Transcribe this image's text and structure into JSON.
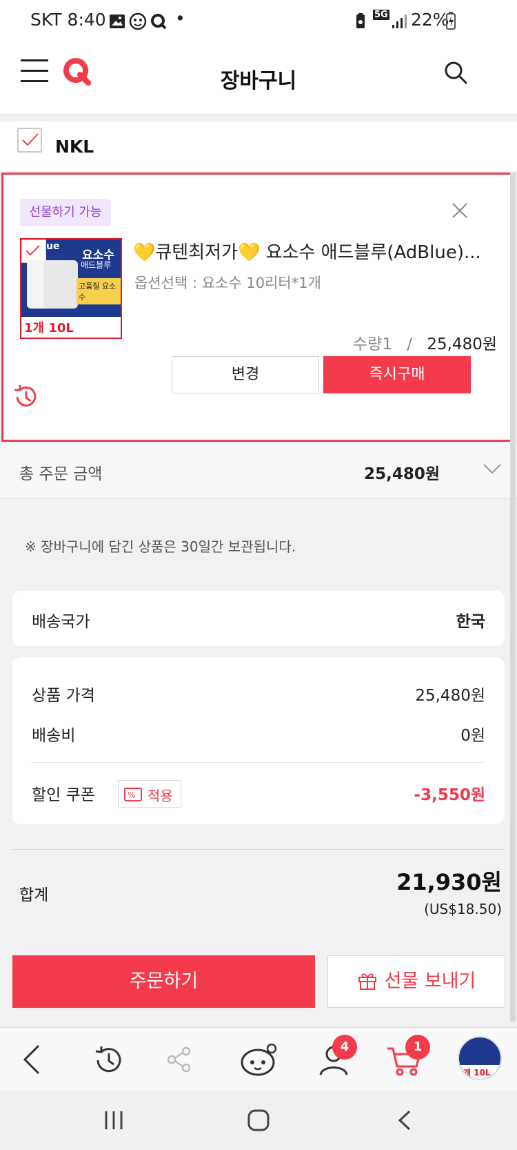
{
  "status_bar": {
    "carrier_time": "SKT 8:40",
    "dot": "•",
    "network": "5G",
    "battery": "22%"
  },
  "header": {
    "title": "장바구니"
  },
  "seller": {
    "name": "NKL"
  },
  "item": {
    "gift_badge": "선물하기 가능",
    "title": "💛큐텐최저가💛 요소수 애드블루(AdBlue)...",
    "option": "옵션선택 : 요소수 10리터*1개",
    "qty": "수량1",
    "sep": "/",
    "price": "25,480원",
    "thumb_text": {
      "brand": "요소수",
      "sub": "애드블루",
      "label": "고품질 요소수",
      "bottom": "1개 10L",
      "corner": "ue"
    },
    "change_label": "변경",
    "buy_now_label": "즉시구매"
  },
  "total_order": {
    "label": "총 주문 금액",
    "value": "25,480원"
  },
  "notice": "※ 장바구니에 담긴 상품은 30일간 보관됩니다.",
  "shipping": {
    "label": "배송국가",
    "value": "한국"
  },
  "price_panel": {
    "product_price_label": "상품 가격",
    "product_price_value": "25,480원",
    "shipping_label": "배송비",
    "shipping_value": "0원",
    "coupon_label": "할인 쿠폰",
    "coupon_apply": "적용",
    "coupon_value": "-3,550원"
  },
  "sum": {
    "label": "합계",
    "value": "21,930원",
    "usd": "(US$18.50)"
  },
  "actions": {
    "order_label": "주문하기",
    "gift_label": "선물 보내기"
  },
  "toolbar": {
    "profile_badge": "4",
    "cart_badge": "1",
    "thumb_text": "개 10L"
  },
  "colors": {
    "accent": "#f33b4b",
    "gift_purple": "#8e3fcb",
    "discount": "#f0394e"
  }
}
